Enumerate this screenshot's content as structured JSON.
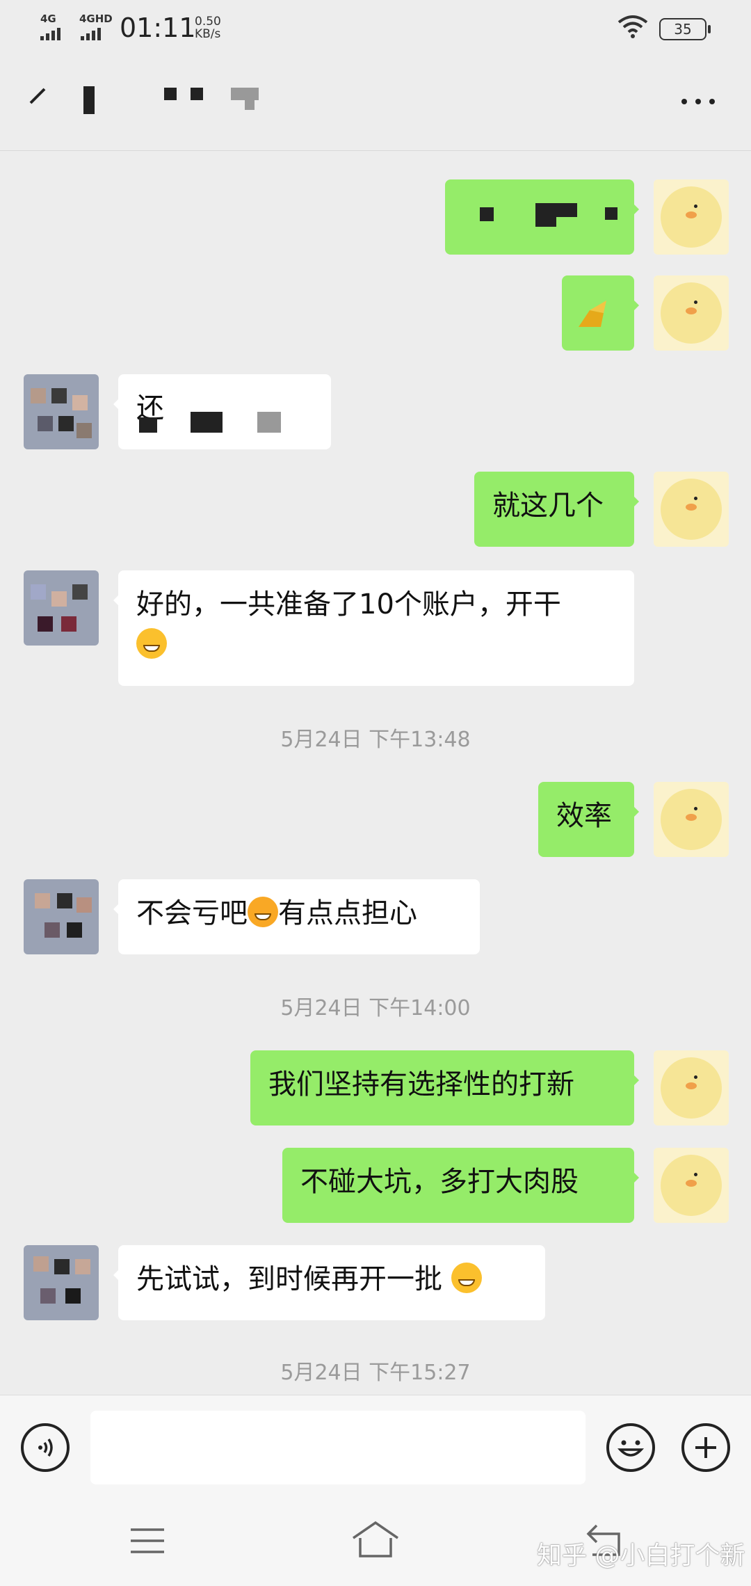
{
  "status_bar": {
    "network1": "4G",
    "network2": "4GHD",
    "time": "01:11",
    "speed_value": "0.50",
    "speed_unit": "KB/s",
    "battery": "35"
  },
  "header": {
    "back_icon": "back-arrow-icon",
    "more_icon": "more-dots-icon"
  },
  "messages": [
    {
      "side": "right",
      "type": "image"
    },
    {
      "side": "right",
      "type": "image"
    },
    {
      "side": "left",
      "type": "text",
      "text": "还"
    },
    {
      "side": "right",
      "type": "text",
      "text": "就这几个"
    },
    {
      "side": "left",
      "type": "text",
      "text": "好的，一共准备了10个账户，开干"
    },
    {
      "side": "center",
      "type": "time",
      "text": "5月24日 下午13:48"
    },
    {
      "side": "right",
      "type": "text",
      "text": "效率"
    },
    {
      "side": "left",
      "type": "text",
      "text_a": "不会亏吧",
      "text_b": "有点点担心"
    },
    {
      "side": "center",
      "type": "time",
      "text": "5月24日 下午14:00"
    },
    {
      "side": "right",
      "type": "text",
      "text": "我们坚持有选择性的打新"
    },
    {
      "side": "right",
      "type": "text",
      "text": "不碰大坑，多打大肉股"
    },
    {
      "side": "left",
      "type": "text",
      "text": "先试试，到时候再开一批"
    },
    {
      "side": "center",
      "type": "time",
      "text": "5月24日 下午15:27"
    }
  ],
  "input_bar": {
    "voice_icon": "voice-icon",
    "emoji_icon": "emoji-icon",
    "add_icon": "plus-icon",
    "input_value": ""
  },
  "nav_bar": {
    "menu_icon": "menu-icon",
    "home_icon": "home-icon",
    "back_icon": "back-icon"
  },
  "watermark": "知乎 @小白打个新",
  "colors": {
    "sent_bubble": "#95ec69",
    "received_bubble": "#ffffff",
    "background": "#ededed"
  }
}
